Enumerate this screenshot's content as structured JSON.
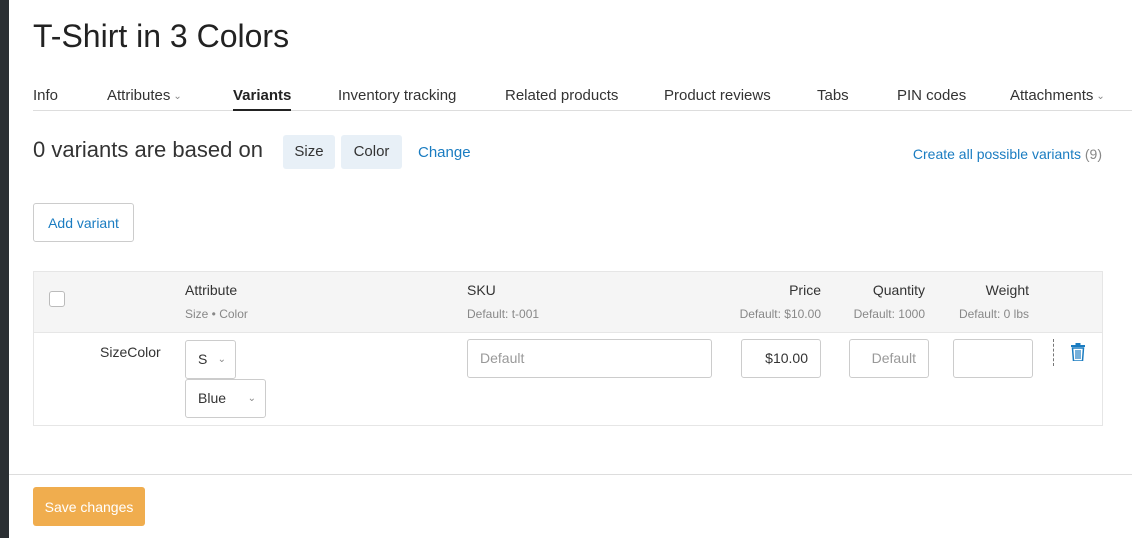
{
  "page": {
    "title": "T-Shirt in 3 Colors"
  },
  "tabs": [
    {
      "label": "Info"
    },
    {
      "label": "Attributes",
      "has_dropdown": true
    },
    {
      "label": "Variants",
      "active": true
    },
    {
      "label": "Inventory tracking"
    },
    {
      "label": "Related products"
    },
    {
      "label": "Product reviews"
    },
    {
      "label": "Tabs"
    },
    {
      "label": "PIN codes"
    },
    {
      "label": "Attachments",
      "has_dropdown": true
    }
  ],
  "variants_header": {
    "text": "0 variants are based on",
    "attributes": [
      "Size",
      "Color"
    ],
    "change_label": "Change",
    "create_all_label": "Create all possible variants",
    "create_all_count": "(9)"
  },
  "add_variant_label": "Add variant",
  "table": {
    "columns": {
      "attribute": {
        "label": "Attribute",
        "sub": "Size • Color"
      },
      "sku": {
        "label": "SKU",
        "sub": "Default: t-001"
      },
      "price": {
        "label": "Price",
        "sub": "Default: $10.00"
      },
      "quantity": {
        "label": "Quantity",
        "sub": "Default: 1000"
      },
      "weight": {
        "label": "Weight",
        "sub": "Default: 0 lbs"
      }
    },
    "rows": [
      {
        "label": "SizeColor",
        "size_value": "S",
        "color_value": "Blue",
        "sku_placeholder": "Default",
        "price_value": "$10.00",
        "quantity_placeholder": "Default",
        "weight_value": ""
      }
    ]
  },
  "save_label": "Save changes",
  "colors": {
    "link": "#1a7cc1",
    "save_button": "#f0ad4e",
    "chip_bg": "#e8f0f7"
  },
  "icons": {
    "delete": "trash-icon",
    "dropdown": "chevron-down-icon"
  }
}
